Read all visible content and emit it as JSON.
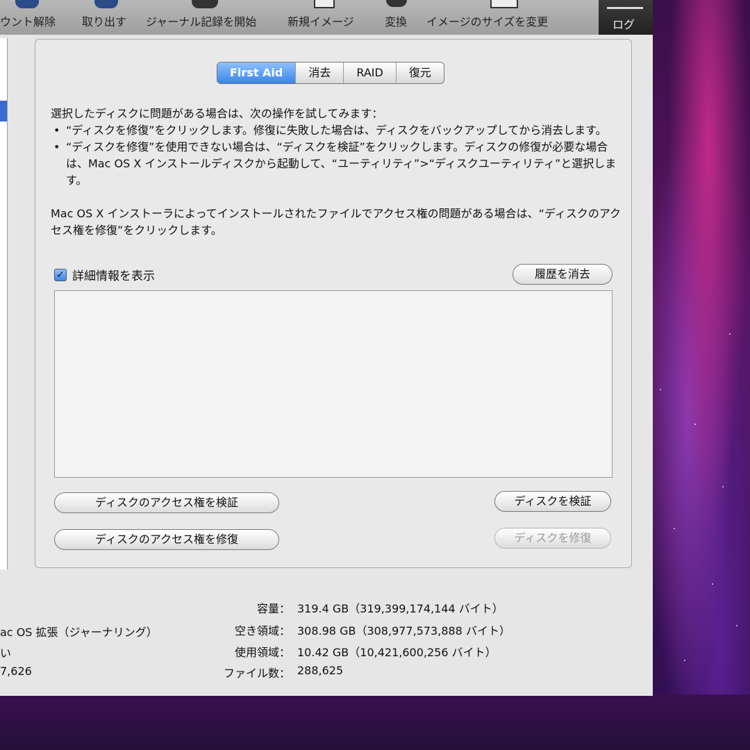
{
  "toolbar": {
    "items": [
      "ウント解除",
      "取り出す",
      "ジャーナル記録を開始",
      "新規イメージ",
      "変換",
      "イメージのサイズを変更"
    ],
    "log_label": "ログ"
  },
  "tabs": [
    "First Aid",
    "消去",
    "RAID",
    "復元"
  ],
  "instructions": {
    "intro": "選択したディスクに問題がある場合は、次の操作を試してみます：",
    "bullet1": "“ディスクを修復”をクリックします。修復に失敗した場合は、ディスクをバックアップしてから消去します。",
    "bullet2": "“ディスクを修復”を使用できない場合は、“ディスクを検証”をクリックします。ディスクの修復が必要な場合は、Mac OS X インストールディスクから起動して、“ユーティリティ”>“ディスクユーティリティ”と選択します。",
    "permissions": "Mac OS X インストーラによってインストールされたファイルでアクセス権の問題がある場合は、“ディスクのアクセス権を修復”をクリックします。"
  },
  "details_label": "詳細情報を表示",
  "details_checked": true,
  "buttons": {
    "clear_history": "履歴を消去",
    "verify_permissions": "ディスクのアクセス権を検証",
    "repair_permissions": "ディスクのアクセス権を修復",
    "verify_disk": "ディスクを検証",
    "repair_disk": "ディスクを修復"
  },
  "disk_info": {
    "capacity_label": "容量：",
    "capacity_value": "319.4 GB（319,399,174,144 バイト）",
    "free_label": "空き領域：",
    "free_value": "308.98 GB（308,977,573,888 バイト）",
    "used_label": "使用領域：",
    "used_value": "10.42 GB（10,421,600,256 バイト）",
    "files_label": "ファイル数：",
    "files_value": "288,625"
  },
  "left_info": {
    "format": "ac OS 拡張（ジャーナリング）",
    "line2": "い",
    "line3": "7,626"
  }
}
